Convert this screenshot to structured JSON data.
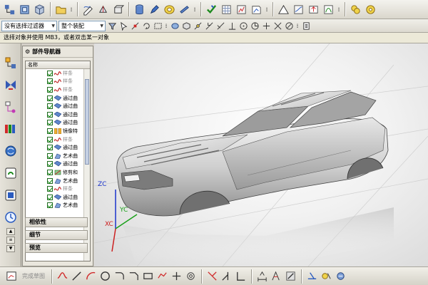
{
  "toolbar": {
    "icons": [
      "part-nav-icon",
      "layer-icon",
      "cube-icon",
      "open-folder-icon",
      "more-icon",
      "sketch-icon",
      "extrude-icon",
      "revolve-icon",
      "more-icon",
      "cylinder-icon",
      "pen-icon",
      "torus-icon",
      "more-icon",
      "measure-icon",
      "check-icon",
      "grid-icon",
      "analysis-icon",
      "more-icon",
      "triangle-icon",
      "surface-icon",
      "feature-icon",
      "sheet-icon",
      "more-icon",
      "sew-icon",
      "trim-icon"
    ]
  },
  "selection_bar": {
    "filter_value": "没有选择过滤器",
    "scope_value": "整个装配"
  },
  "status": {
    "prompt": "选择对象并使用 MB3，或者双击某一对象"
  },
  "navigator": {
    "title": "部件导航器",
    "column_name": "名称",
    "rows": [
      {
        "label": "样条",
        "type": "spline",
        "dim": true
      },
      {
        "label": "样条",
        "type": "spline",
        "dim": true
      },
      {
        "label": "样条",
        "type": "spline",
        "dim": true
      },
      {
        "label": "通过曲",
        "type": "surface",
        "dim": false
      },
      {
        "label": "通过曲",
        "type": "surface",
        "dim": false
      },
      {
        "label": "通过曲",
        "type": "surface",
        "dim": false
      },
      {
        "label": "通过曲",
        "type": "surface",
        "dim": false
      },
      {
        "label": "镜像特",
        "type": "mirror",
        "dim": false
      },
      {
        "label": "样条",
        "type": "spline",
        "dim": true
      },
      {
        "label": "通过曲",
        "type": "surface",
        "dim": false
      },
      {
        "label": "艺术曲",
        "type": "studio",
        "dim": false
      },
      {
        "label": "通过曲",
        "type": "surface",
        "dim": false
      },
      {
        "label": "修剪和",
        "type": "trim",
        "dim": false
      },
      {
        "label": "艺术曲",
        "type": "studio",
        "dim": false
      },
      {
        "label": "样条",
        "type": "spline",
        "dim": true
      },
      {
        "label": "通过曲",
        "type": "surface",
        "dim": false
      },
      {
        "label": "艺术曲",
        "type": "studio",
        "dim": false
      }
    ],
    "sections": [
      "相依性",
      "细节",
      "预览"
    ]
  },
  "viewport": {
    "axis_labels": {
      "z": "ZC",
      "y": "YC",
      "x": "XC"
    }
  },
  "bottom_toolbar": {
    "finish_sketch": "完成草图"
  },
  "colors": {
    "ui_face": "#d4d0c8",
    "check_green": "#0c8a0c",
    "axis_z": "#1a33cc",
    "axis_y": "#18a018",
    "axis_x": "#cc2020"
  }
}
